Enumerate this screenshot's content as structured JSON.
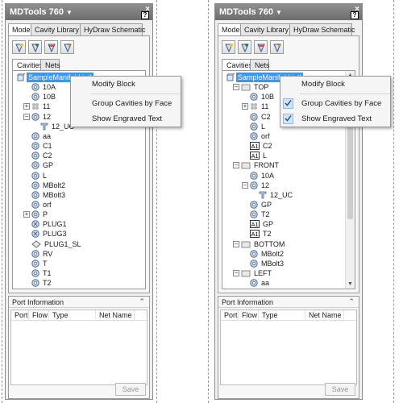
{
  "left": {
    "title": "MDTools 760",
    "help_label": "?",
    "tabs": [
      {
        "label": "Model",
        "active": true
      },
      {
        "label": "Cavity Library",
        "active": false
      },
      {
        "label": "HyDraw Schematic",
        "active": false
      }
    ],
    "subtabs": [
      {
        "label": "Cavities",
        "active": true
      },
      {
        "label": "Nets",
        "active": false
      }
    ],
    "tree": [
      {
        "label": "SampleManifold.iptl",
        "icon": "block",
        "level": 0,
        "selected": true
      },
      {
        "label": "10A",
        "icon": "cavity",
        "level": 1
      },
      {
        "label": "10B",
        "icon": "cavity",
        "level": 1
      },
      {
        "label": "11",
        "icon": "cavity-group",
        "level": 1,
        "expander": "+"
      },
      {
        "label": "12",
        "icon": "cavity",
        "level": 1,
        "expander": "-"
      },
      {
        "label": "12_UC",
        "icon": "engraved",
        "level": 2
      },
      {
        "label": "aa",
        "icon": "cavity",
        "level": 1
      },
      {
        "label": "C1",
        "icon": "cavity",
        "level": 1
      },
      {
        "label": "C2",
        "icon": "cavity",
        "level": 1
      },
      {
        "label": "GP",
        "icon": "cavity",
        "level": 1
      },
      {
        "label": "L",
        "icon": "cavity",
        "level": 1
      },
      {
        "label": "MBolt2",
        "icon": "cavity",
        "level": 1
      },
      {
        "label": "MBolt3",
        "icon": "cavity",
        "level": 1
      },
      {
        "label": "orf",
        "icon": "cavity",
        "level": 1
      },
      {
        "label": "P",
        "icon": "cavity",
        "level": 1,
        "expander": "+"
      },
      {
        "label": "PLUG1",
        "icon": "plug",
        "level": 1
      },
      {
        "label": "PLUG3",
        "icon": "plug",
        "level": 1
      },
      {
        "label": "PLUG1_SL",
        "icon": "plug-slot",
        "level": 1
      },
      {
        "label": "RV",
        "icon": "cavity",
        "level": 1
      },
      {
        "label": "T",
        "icon": "cavity",
        "level": 1
      },
      {
        "label": "T1",
        "icon": "cavity",
        "level": 1
      },
      {
        "label": "T2",
        "icon": "cavity",
        "level": 1
      }
    ],
    "menu": [
      {
        "label": "Modify Block",
        "checked": false
      },
      {
        "label": "Group Cavities by Face",
        "checked": false
      },
      {
        "label": "Show Engraved Text",
        "checked": false
      }
    ],
    "port": {
      "heading": "Port Information",
      "columns": [
        "Port",
        "Flow",
        "Type",
        "Net Name"
      ],
      "save_label": "Save"
    }
  },
  "right": {
    "title": "MDTools 760",
    "help_label": "?",
    "tabs": [
      {
        "label": "Model",
        "active": true
      },
      {
        "label": "Cavity Library",
        "active": false
      },
      {
        "label": "HyDraw Schematic",
        "active": false
      }
    ],
    "subtabs": [
      {
        "label": "Cavities",
        "active": true
      },
      {
        "label": "Nets",
        "active": false
      }
    ],
    "tree": [
      {
        "label": "SampleManifold.iptl",
        "icon": "block",
        "level": 0,
        "selected": true
      },
      {
        "label": "TOP",
        "icon": "face",
        "level": 1,
        "expander": "-"
      },
      {
        "label": "10B",
        "icon": "cavity",
        "level": 2
      },
      {
        "label": "11",
        "icon": "cavity-group",
        "level": 2,
        "expander": "+"
      },
      {
        "label": "C2",
        "icon": "cavity",
        "level": 2
      },
      {
        "label": "L",
        "icon": "cavity",
        "level": 2
      },
      {
        "label": "orf",
        "icon": "cavity",
        "level": 2
      },
      {
        "label": "C2",
        "icon": "engraved-text",
        "level": 2
      },
      {
        "label": "L",
        "icon": "engraved-text",
        "level": 2
      },
      {
        "label": "FRONT",
        "icon": "face",
        "level": 1,
        "expander": "-"
      },
      {
        "label": "10A",
        "icon": "cavity",
        "level": 2
      },
      {
        "label": "12",
        "icon": "cavity",
        "level": 2,
        "expander": "-"
      },
      {
        "label": "12_UC",
        "icon": "engraved",
        "level": 3
      },
      {
        "label": "GP",
        "icon": "cavity",
        "level": 2
      },
      {
        "label": "T2",
        "icon": "cavity",
        "level": 2
      },
      {
        "label": "GP",
        "icon": "engraved-text",
        "level": 2
      },
      {
        "label": "T2",
        "icon": "engraved-text",
        "level": 2
      },
      {
        "label": "BOTTOM",
        "icon": "face",
        "level": 1,
        "expander": "-"
      },
      {
        "label": "MBolt2",
        "icon": "cavity",
        "level": 2
      },
      {
        "label": "MBolt3",
        "icon": "cavity",
        "level": 2
      },
      {
        "label": "LEFT",
        "icon": "face",
        "level": 1,
        "expander": "-"
      },
      {
        "label": "aa",
        "icon": "cavity",
        "level": 2
      }
    ],
    "menu": [
      {
        "label": "Modify Block",
        "checked": false
      },
      {
        "label": "Group Cavities by Face",
        "checked": true
      },
      {
        "label": "Show Engraved Text",
        "checked": true
      }
    ],
    "port": {
      "heading": "Port Information",
      "columns": [
        "Port",
        "Flow",
        "Type",
        "Net Name"
      ],
      "save_label": "Save"
    }
  }
}
